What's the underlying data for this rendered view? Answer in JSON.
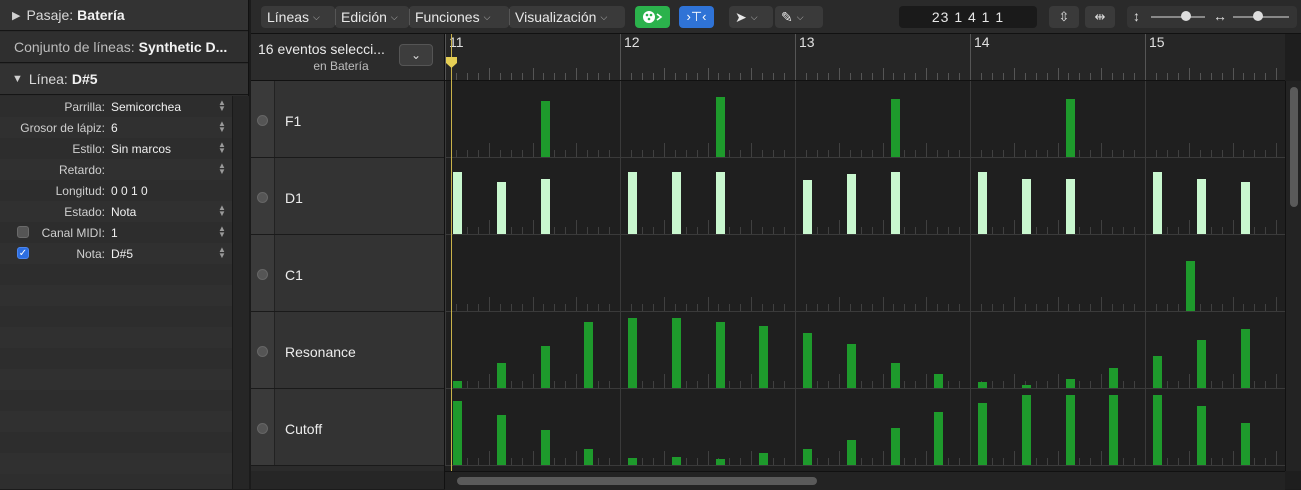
{
  "inspector": {
    "region_label": "Pasaje:",
    "region_value": "Batería",
    "lineset_label": "Conjunto de líneas:",
    "lineset_value": "Synthetic D...",
    "line_label": "Línea:",
    "line_value": "D#5",
    "params": [
      {
        "label": "Parrilla:",
        "value": "Semicorchea",
        "stepper": true
      },
      {
        "label": "Grosor de lápiz:",
        "value": "6",
        "stepper": true
      },
      {
        "label": "Estilo:",
        "value": "Sin marcos",
        "stepper": true
      },
      {
        "label": "Retardo:",
        "value": "",
        "stepper": true
      },
      {
        "label": "Longitud:",
        "value": "0  0  1      0",
        "stepper": false
      },
      {
        "label": "Estado:",
        "value": "Nota",
        "stepper": true
      },
      {
        "label": "Canal MIDI:",
        "value": "1",
        "stepper": true,
        "checkbox": false
      },
      {
        "label": "Nota:",
        "value": "D#5",
        "stepper": true,
        "checkbox": true
      }
    ]
  },
  "toolbar": {
    "menus": [
      "Líneas",
      "Edición",
      "Funciones",
      "Visualización"
    ],
    "position": "23  1 4 1 1",
    "icons": {
      "midi_in": "palette-icon",
      "catch": "catch-playhead-icon",
      "pointer": "pointer-tool-icon",
      "pencil": "pencil-tool-icon"
    }
  },
  "selection": {
    "title": "16 eventos selecci...",
    "subtitle": "en Batería"
  },
  "ruler": {
    "bars": [
      "11",
      "12",
      "13",
      "14",
      "15"
    ]
  },
  "lanes": [
    {
      "name": "F1",
      "color": "#1e9a2c",
      "mode": "bar",
      "events": [
        [
          2,
          0.78
        ],
        [
          6,
          0.83
        ],
        [
          10,
          0.8
        ],
        [
          14,
          0.8
        ]
      ]
    },
    {
      "name": "D1",
      "color": "#c9f7cf",
      "mode": "bar",
      "events": [
        [
          0,
          0.86
        ],
        [
          1,
          0.72
        ],
        [
          2,
          0.77
        ],
        [
          4,
          0.86
        ],
        [
          5,
          0.86
        ],
        [
          6,
          0.86
        ],
        [
          8,
          0.75
        ],
        [
          9,
          0.83
        ],
        [
          10,
          0.86
        ],
        [
          12,
          0.86
        ],
        [
          13,
          0.77
        ],
        [
          14,
          0.77
        ],
        [
          16,
          0.86
        ],
        [
          17,
          0.77
        ],
        [
          18,
          0.72
        ]
      ]
    },
    {
      "name": "C1",
      "color": "#1e9a2c",
      "mode": "bar",
      "events": [
        [
          16.75,
          0.7
        ]
      ]
    },
    {
      "name": "Resonance",
      "color": "#1e9a2c",
      "mode": "bar",
      "events": [
        [
          0,
          0.1
        ],
        [
          1,
          0.35
        ],
        [
          2,
          0.58
        ],
        [
          3,
          0.92
        ],
        [
          4,
          0.97
        ],
        [
          5,
          0.97
        ],
        [
          6,
          0.92
        ],
        [
          7,
          0.86
        ],
        [
          8,
          0.77
        ],
        [
          9,
          0.61
        ],
        [
          10,
          0.35
        ],
        [
          11,
          0.2
        ],
        [
          12,
          0.09
        ],
        [
          13,
          0.04
        ],
        [
          14,
          0.12
        ],
        [
          15,
          0.28
        ],
        [
          16,
          0.45
        ],
        [
          17,
          0.66
        ],
        [
          18,
          0.82
        ]
      ]
    },
    {
      "name": "Cutoff",
      "color": "#1e9a2c",
      "mode": "bar",
      "events": [
        [
          0,
          0.89
        ],
        [
          1,
          0.7
        ],
        [
          2,
          0.48
        ],
        [
          3,
          0.22
        ],
        [
          4,
          0.1
        ],
        [
          5,
          0.11
        ],
        [
          6,
          0.09
        ],
        [
          7,
          0.17
        ],
        [
          8,
          0.22
        ],
        [
          9,
          0.35
        ],
        [
          10,
          0.51
        ],
        [
          11,
          0.73
        ],
        [
          12,
          0.86
        ],
        [
          13,
          0.97
        ],
        [
          14,
          0.97
        ],
        [
          15,
          0.97
        ],
        [
          16,
          0.97
        ],
        [
          17,
          0.82
        ],
        [
          18,
          0.59
        ]
      ]
    }
  ]
}
